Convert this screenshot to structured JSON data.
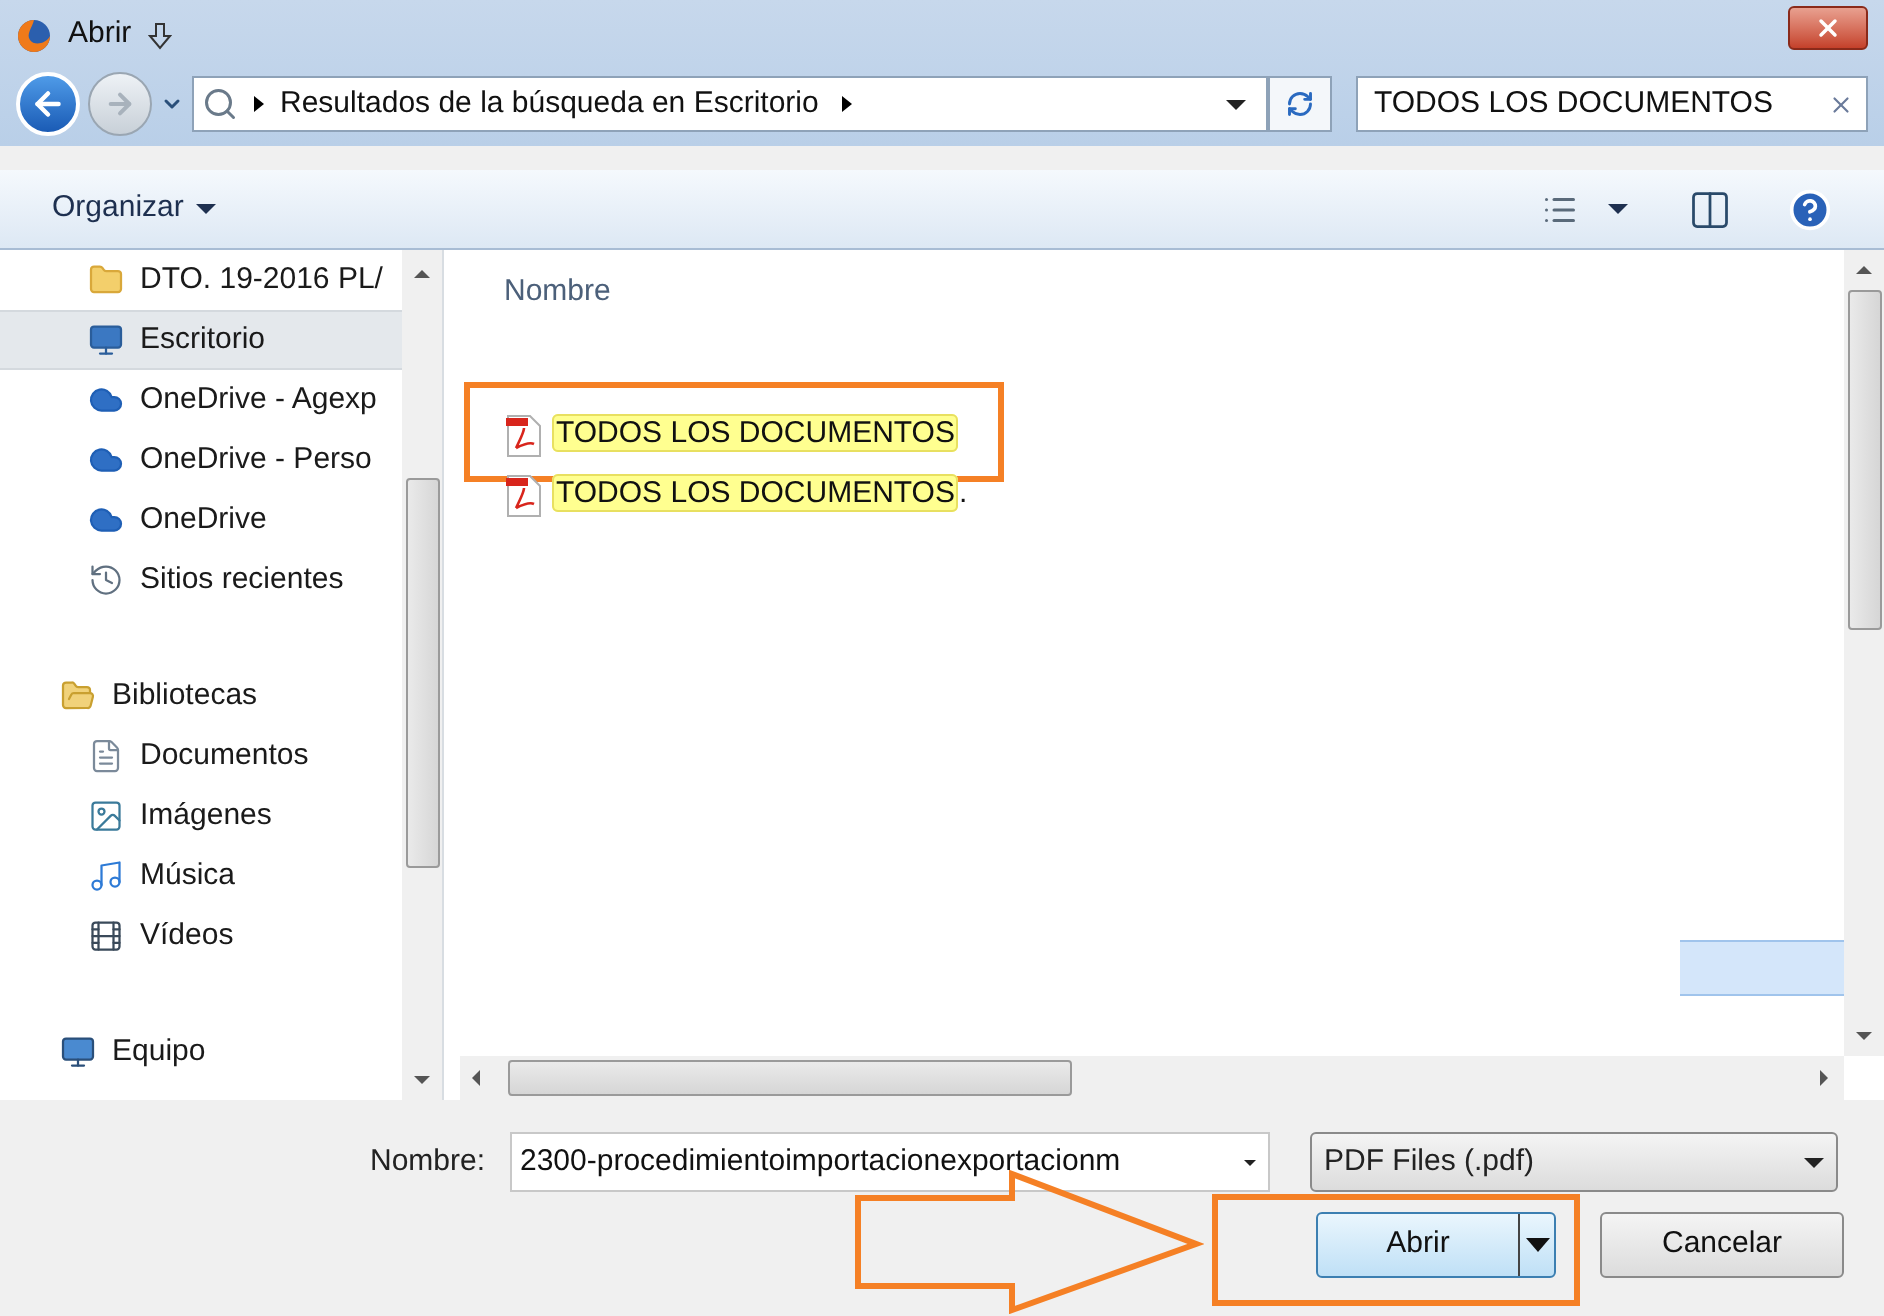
{
  "window": {
    "title": "Abrir"
  },
  "address_bar": {
    "path": "Resultados de la búsqueda en Escritorio"
  },
  "search": {
    "value": "TODOS LOS DOCUMENTOS"
  },
  "toolbar": {
    "organize": "Organizar"
  },
  "sidebar": {
    "sections": [
      {
        "items": [
          {
            "label": "DTO. 19-2016 PL/",
            "kind": "folder",
            "selected": false
          },
          {
            "label": "Escritorio",
            "kind": "desktop",
            "selected": true
          },
          {
            "label": "OneDrive - Agexp",
            "kind": "cloud",
            "selected": false
          },
          {
            "label": "OneDrive - Perso",
            "kind": "cloud",
            "selected": false
          },
          {
            "label": "OneDrive",
            "kind": "cloud",
            "selected": false
          },
          {
            "label": "Sitios recientes",
            "kind": "recent",
            "selected": false
          }
        ]
      },
      {
        "items": [
          {
            "label": "Bibliotecas",
            "kind": "library",
            "selected": false,
            "children": [
              {
                "label": "Documentos",
                "kind": "document",
                "selected": false
              },
              {
                "label": "Imágenes",
                "kind": "image",
                "selected": false
              },
              {
                "label": "Música",
                "kind": "music",
                "selected": false
              },
              {
                "label": "Vídeos",
                "kind": "video",
                "selected": false
              }
            ]
          }
        ]
      },
      {
        "items": [
          {
            "label": "Equipo",
            "kind": "computer",
            "selected": false
          }
        ]
      }
    ]
  },
  "file_list": {
    "columns": [
      "Nombre"
    ],
    "files": [
      {
        "match": "TODOS LOS DOCUMENTOS",
        "outlined": true
      },
      {
        "match": "TODOS LOS DOCUMENTOS",
        "rest": ".",
        "outlined": false
      }
    ]
  },
  "footer": {
    "name_label": "Nombre:",
    "file_name": "2300-procedimientoimportacionexportacionm",
    "filter": "PDF Files (.pdf)",
    "open_button": {
      "label": "Abrir",
      "outlined": true
    },
    "cancel_button": "Cancelar",
    "pointer_arrow": true
  }
}
